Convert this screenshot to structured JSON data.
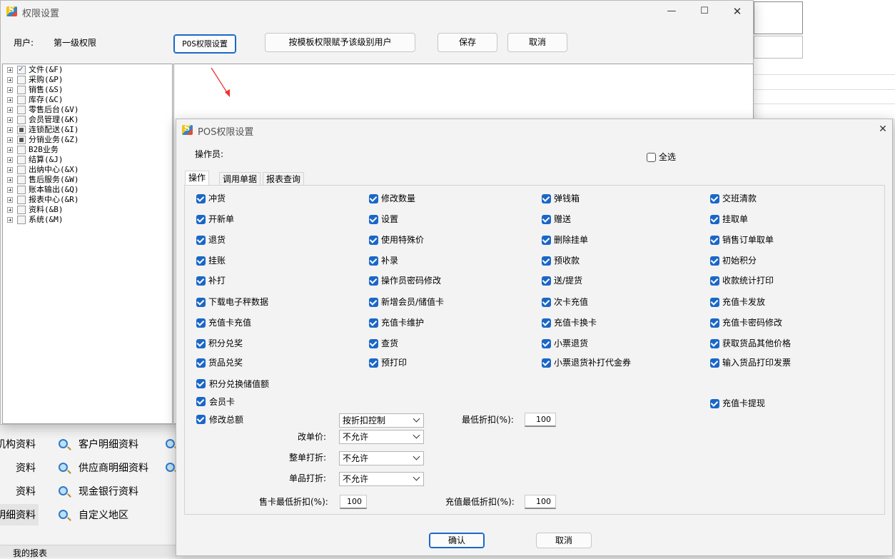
{
  "bg": {
    "bottom_items": [
      {
        "label": "机构资料",
        "col": 0,
        "row": 0
      },
      {
        "label": "资料",
        "col": 0,
        "row": 1
      },
      {
        "label": "资料",
        "col": 0,
        "row": 2
      },
      {
        "label": "明细资料",
        "col": 0,
        "row": 3
      },
      {
        "label": "客户明细资料",
        "col": 1,
        "row": 0
      },
      {
        "label": "供应商明细资料",
        "col": 1,
        "row": 1
      },
      {
        "label": "现金银行资料",
        "col": 1,
        "row": 2
      },
      {
        "label": "自定义地区",
        "col": 1,
        "row": 3
      }
    ],
    "status": "我的报表"
  },
  "perm_window": {
    "title": "权限设置",
    "user_label": "用户:",
    "user_value": "第一级权限",
    "pos_btn": "POS权限设置",
    "template_btn": "按模板权限赋予该级别用户",
    "save_btn": "保存",
    "cancel_btn": "取消",
    "tree": [
      {
        "label": "文件(&F)",
        "state": "checked"
      },
      {
        "label": "采购(&P)",
        "state": "off"
      },
      {
        "label": "销售(&S)",
        "state": "off"
      },
      {
        "label": "库存(&C)",
        "state": "off"
      },
      {
        "label": "零售后台(&V)",
        "state": "off"
      },
      {
        "label": "会员管理(&K)",
        "state": "off"
      },
      {
        "label": "连锁配送(&I)",
        "state": "partial"
      },
      {
        "label": "分销业务(&Z)",
        "state": "partial"
      },
      {
        "label": "B2B业务",
        "state": "off"
      },
      {
        "label": "结算(&J)",
        "state": "off"
      },
      {
        "label": "出纳中心(&X)",
        "state": "off"
      },
      {
        "label": "售后服务(&W)",
        "state": "off"
      },
      {
        "label": "账本输出(&Q)",
        "state": "off"
      },
      {
        "label": "报表中心(&R)",
        "state": "off"
      },
      {
        "label": "资料(&B)",
        "state": "off"
      },
      {
        "label": "系统(&M)",
        "state": "off"
      }
    ]
  },
  "pos_dialog": {
    "title": "POS权限设置",
    "operator_label": "操作员:",
    "select_all": "全选",
    "tabs": [
      "操作",
      "调用单据",
      "报表查询"
    ],
    "checkboxes": [
      [
        "冲货",
        "修改数量",
        "弹钱箱",
        "交班清款"
      ],
      [
        "开新单",
        "设置",
        "赠送",
        "挂取单"
      ],
      [
        "退货",
        "使用特殊价",
        "删除挂单",
        "销售订单取单"
      ],
      [
        "挂账",
        "补录",
        "预收款",
        "初始积分"
      ],
      [
        "补打",
        "操作员密码修改",
        "送/提货",
        "收款统计打印"
      ],
      [
        "下载电子秤数据",
        "新增会员/储值卡",
        "次卡充值",
        "充值卡发放"
      ],
      [
        "充值卡充值",
        "充值卡维护",
        "充值卡换卡",
        "充值卡密码修改"
      ],
      [
        "积分兑奖",
        "查货",
        "小票退货",
        "获取货品其他价格"
      ],
      [
        "货品兑奖",
        "预打印",
        "小票退货补打代金券",
        "输入货品打印发票"
      ]
    ],
    "extra": {
      "points_stored": "积分兑换储值额",
      "member_card": "会员卡",
      "card_withdraw": "充值卡提现",
      "modify_total": "修改总额"
    },
    "discount_mode": "按折扣控制",
    "min_discount_label": "最低折扣(%):",
    "min_discount": "100",
    "change_price_label": "改单价:",
    "change_price": "不允许",
    "whole_discount_label": "整单打折:",
    "whole_discount": "不允许",
    "item_discount_label": "单品打折:",
    "item_discount": "不允许",
    "card_min_label": "售卡最低折扣(%):",
    "card_min": "100",
    "recharge_min_label": "充值最低折扣(%):",
    "recharge_min": "100",
    "ok_btn": "确认",
    "cancel_btn": "取消"
  }
}
